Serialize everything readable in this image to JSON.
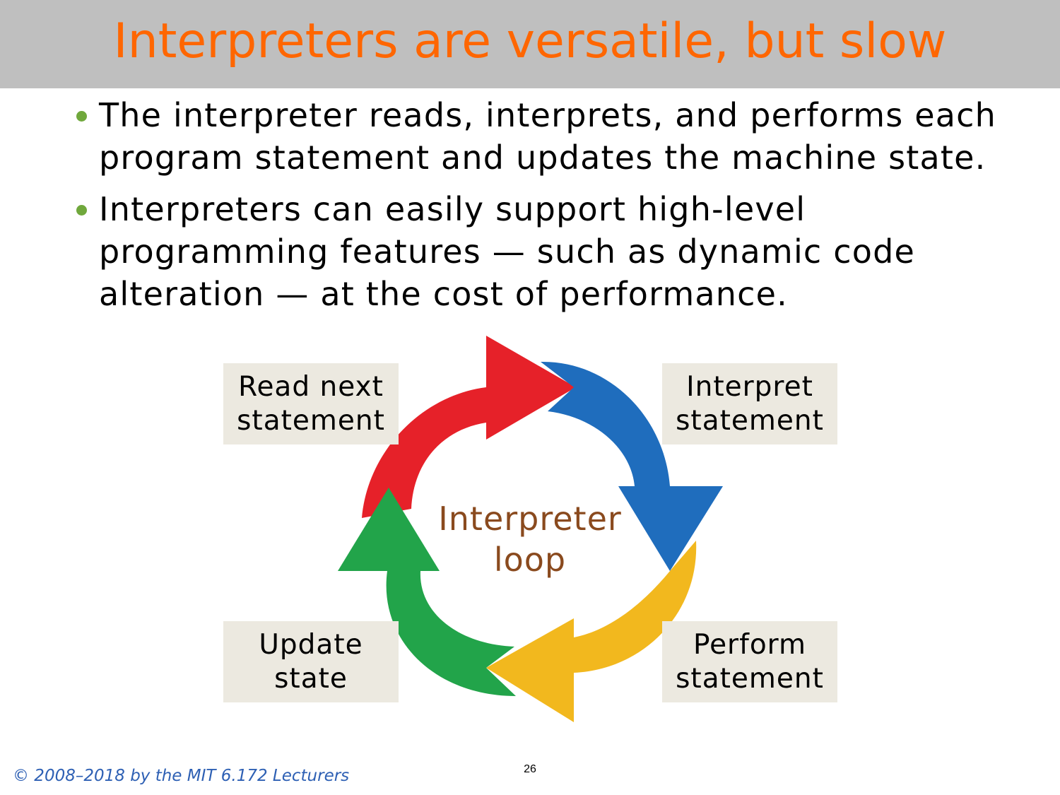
{
  "slide": {
    "title": "Interpreters are versatile, but slow",
    "bullets": [
      "The interpreter reads, interprets, and performs each program statement and updates the machine state.",
      "Interpreters can easily support high-level programming features — such as dynamic code alteration — at the cost of performance."
    ],
    "footer": "© 2008–2018 by the MIT 6.172 Lecturers",
    "page_number": "26"
  },
  "diagram": {
    "center_label": "Interpreter\nloop",
    "steps": [
      {
        "label": "Read next\nstatement",
        "color": "#e62129"
      },
      {
        "label": "Interpret\nstatement",
        "color": "#1f6dbd"
      },
      {
        "label": "Perform\nstatement",
        "color": "#f2b81e"
      },
      {
        "label": "Update\nstate",
        "color": "#22a44a"
      }
    ]
  },
  "colors": {
    "title": "#ff6600",
    "title_bar": "#bfbfbf",
    "bullet_dot": "#70a83c",
    "step_box": "#ece9e0",
    "center_label": "#8a4a1e",
    "footer": "#2e60b4"
  }
}
